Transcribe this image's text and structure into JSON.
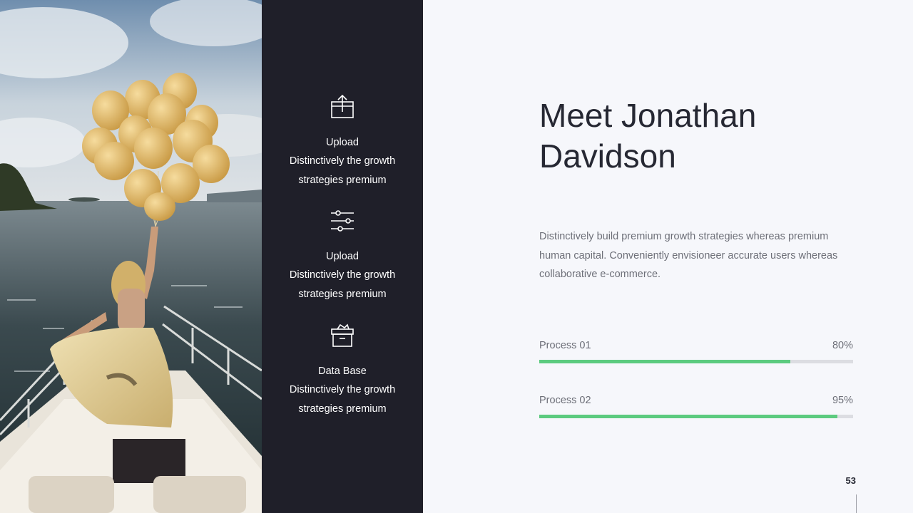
{
  "photo": {
    "alt": "Woman on a boat bow holding balloons over the sea"
  },
  "features": [
    {
      "icon": "upload-box-icon",
      "title": "Upload",
      "desc": "Distinctively the growth strategies premium"
    },
    {
      "icon": "sliders-icon",
      "title": "Upload",
      "desc": "Distinctively the growth strategies premium"
    },
    {
      "icon": "database-box-icon",
      "title": "Data Base",
      "desc": "Distinctively the growth strategies premium"
    }
  ],
  "main": {
    "title": "Meet Jonathan Davidson",
    "intro": "Distinctively build premium growth strategies whereas premium human capital. Conveniently envisioneer accurate users whereas collaborative e-commerce."
  },
  "processes": [
    {
      "label": "Process 01",
      "value_label": "80%",
      "value": 0.8
    },
    {
      "label": "Process 02",
      "value_label": "95%",
      "value": 0.95
    }
  ],
  "page_number": "53",
  "colors": {
    "sidebar": "#1f1f29",
    "accent": "#5ccb7f",
    "track": "#dcdde2",
    "background": "#f6f7fb"
  }
}
